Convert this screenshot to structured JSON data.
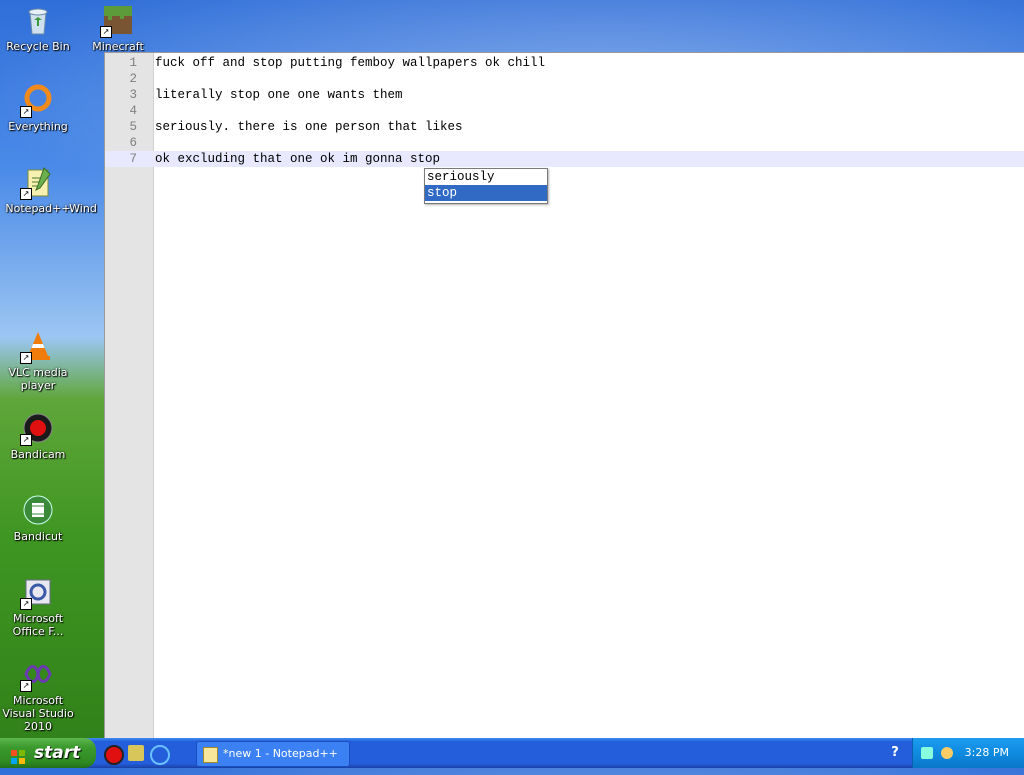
{
  "desktop": {
    "icons": [
      {
        "label": "Recycle Bin",
        "icon": "recycle-bin-icon"
      },
      {
        "label": "Minecraft",
        "icon": "minecraft-icon"
      },
      {
        "label": "Everything",
        "icon": "everything-icon"
      },
      {
        "label": "Notepad++",
        "icon": "notepadpp-icon"
      },
      {
        "label": "Wind",
        "icon": "windows-icon"
      },
      {
        "label": "VLC media player",
        "icon": "vlc-icon"
      },
      {
        "label": "Bandicam",
        "icon": "bandicam-icon"
      },
      {
        "label": "Bandicut",
        "icon": "bandicut-icon"
      },
      {
        "label": "Microsoft Office F...",
        "icon": "office-icon"
      },
      {
        "label": "Microsoft Visual Studio 2010",
        "icon": "visual-studio-icon"
      }
    ]
  },
  "editor": {
    "lines": [
      {
        "num": "1",
        "text": "fuck off and stop putting femboy wallpapers ok chill"
      },
      {
        "num": "2",
        "text": ""
      },
      {
        "num": "3",
        "text": "literally stop one one wants them"
      },
      {
        "num": "4",
        "text": ""
      },
      {
        "num": "5",
        "text": "seriously. there is one person that likes"
      },
      {
        "num": "6",
        "text": ""
      },
      {
        "num": "7",
        "text": "ok excluding that one ok im gonna stop"
      }
    ],
    "current_line": "7",
    "autocomplete": {
      "items": [
        "seriously",
        "stop"
      ],
      "selected": "stop"
    }
  },
  "taskbar": {
    "start_label": "start",
    "task_button_label": "*new 1 - Notepad++",
    "clock": "3:28 PM"
  },
  "colors": {
    "selection": "#316ac5",
    "taskbar": "#245edb",
    "start_button": "#3c9a2e"
  }
}
